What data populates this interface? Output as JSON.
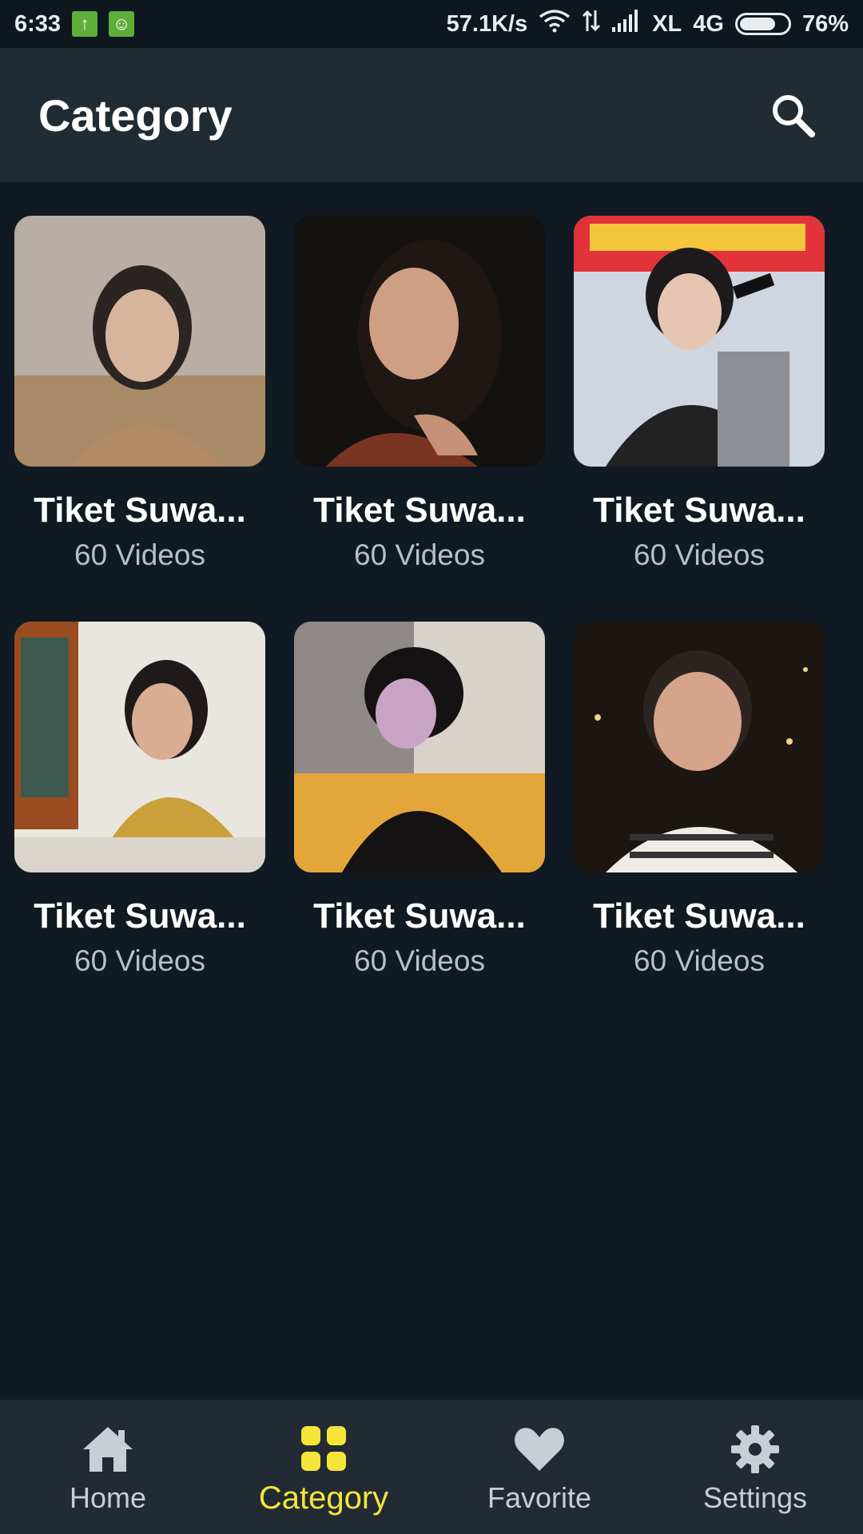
{
  "status_bar": {
    "time": "6:33",
    "speed": "57.1K/s",
    "carrier": "XL",
    "network": "4G",
    "battery_percent": "76%",
    "battery_level": 0.76
  },
  "app_bar": {
    "title": "Category",
    "search_icon": "search-icon"
  },
  "categories": [
    {
      "name": "Tiket Suwa...",
      "count": "60 Videos"
    },
    {
      "name": "Tiket Suwa...",
      "count": "60 Videos"
    },
    {
      "name": "Tiket Suwa...",
      "count": "60 Videos"
    },
    {
      "name": "Tiket Suwa...",
      "count": "60 Videos"
    },
    {
      "name": "Tiket Suwa...",
      "count": "60 Videos"
    },
    {
      "name": "Tiket Suwa...",
      "count": "60 Videos"
    }
  ],
  "bottom_nav": {
    "items": [
      {
        "label": "Home",
        "icon": "home-icon",
        "active": false
      },
      {
        "label": "Category",
        "icon": "grid-icon",
        "active": true
      },
      {
        "label": "Favorite",
        "icon": "heart-icon",
        "active": false
      },
      {
        "label": "Settings",
        "icon": "gear-icon",
        "active": false
      }
    ],
    "active_color": "#f5e53a",
    "inactive_color": "#c8ced3"
  },
  "colors": {
    "background": "#111a22",
    "app_bar": "#212b34",
    "accent": "#f5e53a"
  }
}
